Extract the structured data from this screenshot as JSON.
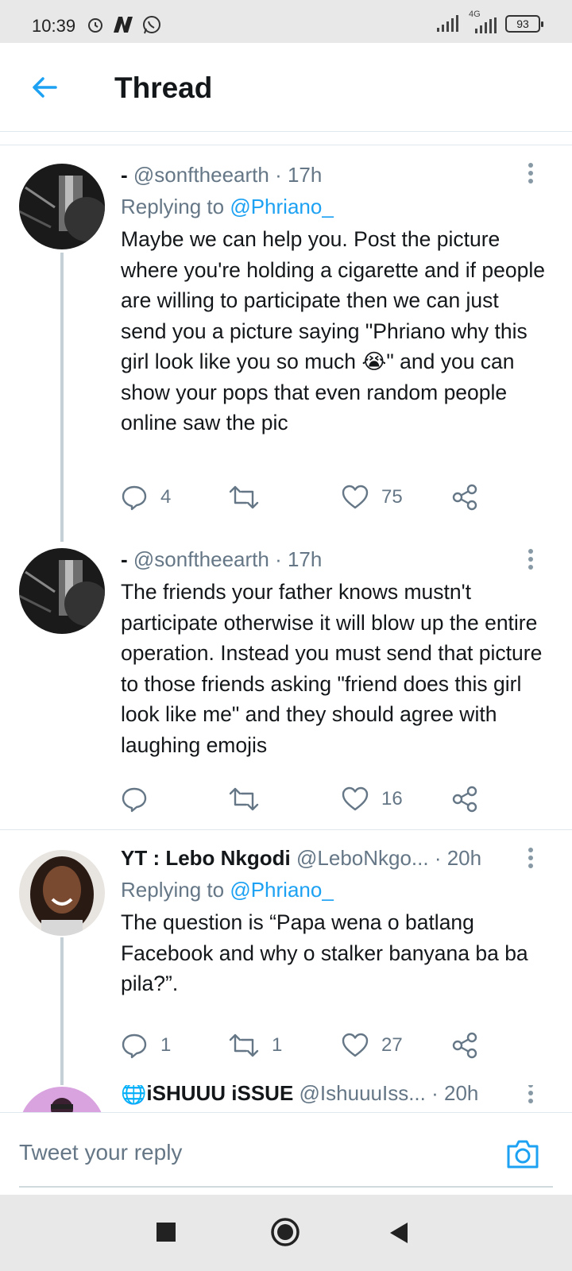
{
  "status_bar": {
    "time": "10:39",
    "network": "4G",
    "battery": "93"
  },
  "header": {
    "title": "Thread"
  },
  "tweets": [
    {
      "name": "-",
      "handle": "@sonftheearth",
      "time": "· 17h",
      "replying_label": "Replying to",
      "replying_to": "@Phriano_",
      "text": "Maybe we can help you. Post the picture where you're holding a cigarette and if people  are willing to participate then we can just send you a picture saying \"Phriano why this girl look like you so much 😭\" and you can show your pops that even random people online saw the pic",
      "replies": "4",
      "retweets": "",
      "likes": "75"
    },
    {
      "name": "-",
      "handle": "@sonftheearth",
      "time": "· 17h",
      "text": "The friends your father knows mustn't participate otherwise it will blow up the entire operation. Instead you must send that picture to those friends asking \"friend does this girl look like me\" and they should agree with laughing emojis",
      "replies": "",
      "retweets": "",
      "likes": "16"
    },
    {
      "name": "YT : Lebo Nkgodi",
      "handle": "@LeboNkgo...",
      "time": "· 20h",
      "replying_label": "Replying to",
      "replying_to": "@Phriano_",
      "text": "The question is “Papa wena o batlang Facebook and why o stalker banyana ba ba pila?”.",
      "replies": "1",
      "retweets": "1",
      "likes": "27"
    },
    {
      "name": "🌐iSHUUU iSSUE",
      "handle": "@IshuuuIss...",
      "time": "· 20h"
    }
  ],
  "reply_bar": {
    "placeholder": "Tweet your reply"
  },
  "colors": {
    "accent": "#1da1f2",
    "muted": "#657786",
    "text": "#14171a"
  }
}
